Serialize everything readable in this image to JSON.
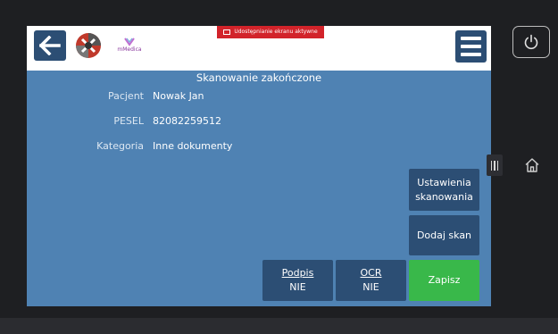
{
  "header": {
    "brand_name": "mMedica",
    "share_notice": "Udostępnianie ekranu aktywne"
  },
  "title": "Skanowanie zakończone",
  "fields": [
    {
      "label": "Pacjent",
      "value": "Nowak Jan"
    },
    {
      "label": "PESEL",
      "value": "82082259512"
    },
    {
      "label": "Kategoria",
      "value": "Inne dokumenty"
    }
  ],
  "buttons": {
    "scan_settings": "Ustawienia\nskanowania",
    "add_scan": "Dodaj skan",
    "signature_label": "Podpis",
    "signature_value": "NIE",
    "ocr_label": "OCR",
    "ocr_value": "NIE",
    "save": "Zapisz"
  },
  "icons": {
    "back": "arrow-left-icon",
    "menu": "hamburger-menu-icon",
    "power": "power-icon",
    "home": "home-icon",
    "handle": "side-handle-icon",
    "share": "screen-share-icon"
  },
  "colors": {
    "panel": "#4f82b3",
    "button_dark": "#2c4e74",
    "save": "#39b84a",
    "share_badge": "#d2232a"
  }
}
